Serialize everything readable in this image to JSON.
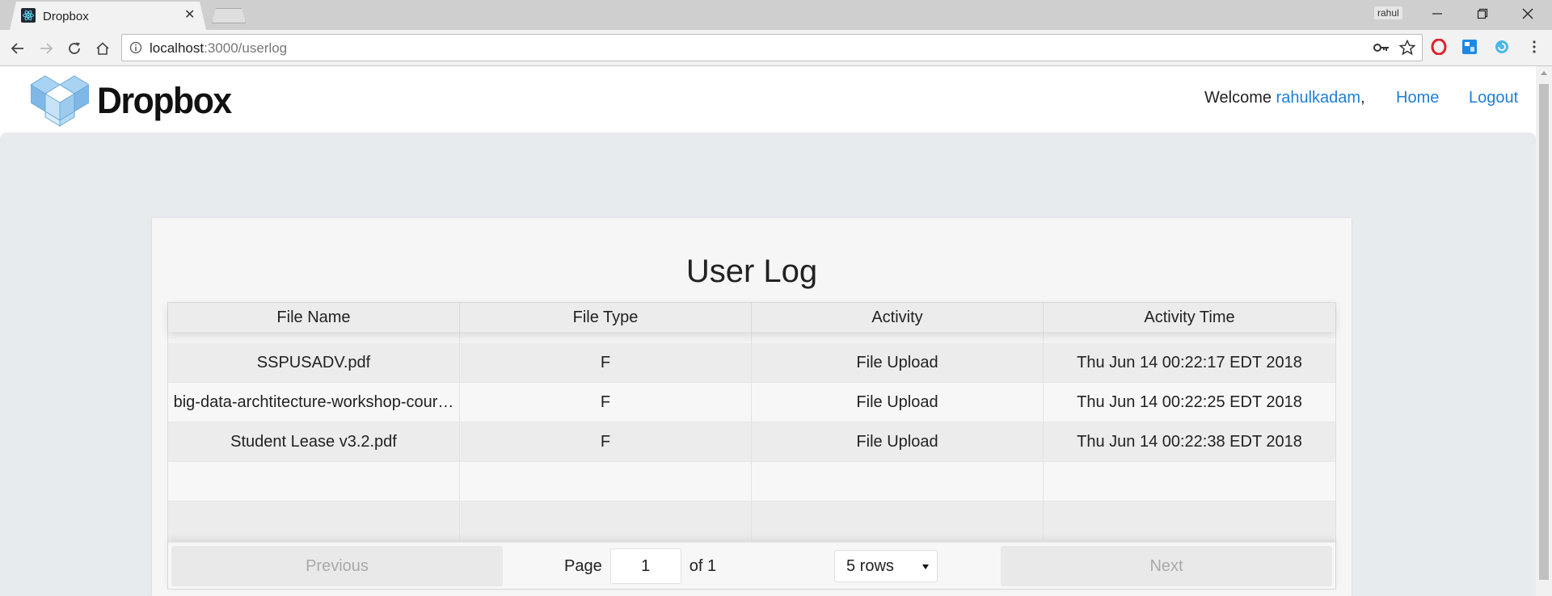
{
  "browser": {
    "tab_title": "Dropbox",
    "tab_close": "✕",
    "profile_name": "rahul",
    "url_host": "localhost",
    "url_path": ":3000/userlog"
  },
  "header": {
    "logo_text": "Dropbox",
    "welcome_prefix": "Welcome ",
    "username": "rahulkadam",
    "welcome_suffix": ",",
    "home_label": "Home",
    "logout_label": "Logout"
  },
  "main": {
    "title": "User Log",
    "columns": [
      "File Name",
      "File Type",
      "Activity",
      "Activity Time"
    ],
    "rows": [
      [
        "SSPUSADV.pdf",
        "F",
        "File Upload",
        "Thu Jun 14 00:22:17 EDT 2018"
      ],
      [
        "big-data-archtitecture-workshop-cour…",
        "F",
        "File Upload",
        "Thu Jun 14 00:22:25 EDT 2018"
      ],
      [
        "Student Lease v3.2.pdf",
        "F",
        "File Upload",
        "Thu Jun 14 00:22:38 EDT 2018"
      ],
      [
        "",
        "",
        "",
        ""
      ],
      [
        "",
        "",
        "",
        ""
      ]
    ],
    "pagination": {
      "previous_label": "Previous",
      "page_label": "Page",
      "current_page": "1",
      "of_label": "of 1",
      "rows_selected": "5 rows",
      "next_label": "Next"
    }
  },
  "colors": {
    "link": "#1e7fd6",
    "page_bg": "#e8ebee",
    "logo_blue": "#7fb8e6"
  }
}
